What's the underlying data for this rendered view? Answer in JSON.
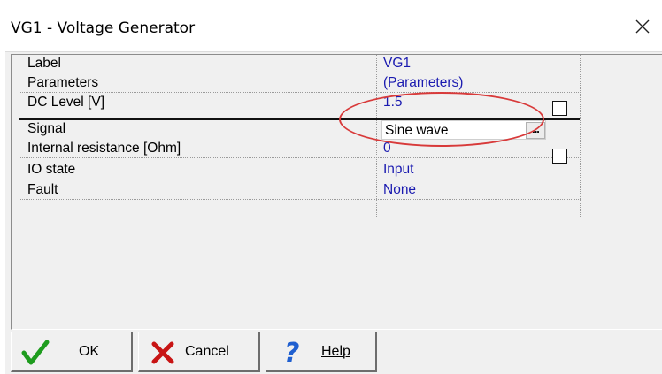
{
  "window": {
    "title": "VG1 - Voltage Generator",
    "close_glyph": "✕"
  },
  "properties": [
    {
      "name": "Label",
      "value": "VG1",
      "checkbox": false
    },
    {
      "name": "Parameters",
      "value": "(Parameters)",
      "checkbox": false
    },
    {
      "name": "DC Level [V]",
      "value": "1.5",
      "checkbox": true
    },
    {
      "name": "Signal",
      "value": "Sine wave",
      "selected": true,
      "editor_button": "..."
    },
    {
      "name": "Internal resistance [Ohm]",
      "value": "0",
      "checkbox": true
    },
    {
      "name": "IO state",
      "value": "Input",
      "checkbox": false
    },
    {
      "name": "Fault",
      "value": "None",
      "checkbox": false
    }
  ],
  "buttons": {
    "ok": "OK",
    "cancel": "Cancel",
    "help": "Help"
  },
  "colors": {
    "value_text": "#1a1ab0",
    "highlight": "#d83a3a",
    "ok_check": "#1e9c1e",
    "cancel_x": "#c81414",
    "help_q": "#1f5fd0"
  }
}
